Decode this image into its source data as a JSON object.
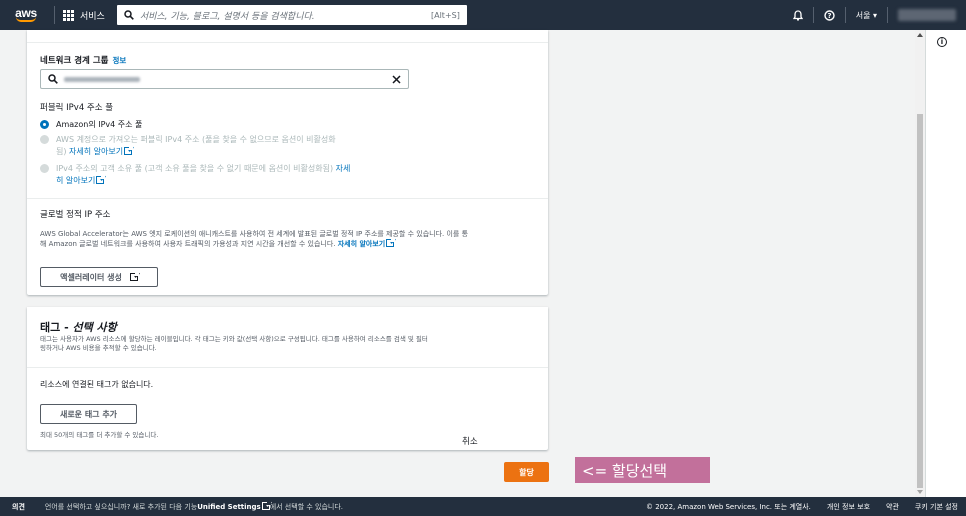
{
  "topnav": {
    "logo": "aws",
    "services_label": "서비스",
    "search_placeholder": "서비스, 기능, 블로그, 설명서 등을 검색합니다.",
    "search_shortcut": "[Alt+S]",
    "region": "서울 ▾",
    "icons": [
      "grid-icon",
      "search-icon",
      "bell-icon",
      "help-icon"
    ]
  },
  "network": {
    "label": "네트워크 경계 그룹",
    "info": "정보",
    "field_value": "ap-northeast-2"
  },
  "pool": {
    "label": "퍼블릭 IPv4 주소 풀",
    "options": [
      {
        "text": "Amazon의 IPv4 주소 풀",
        "selected": true,
        "disabled": false
      },
      {
        "line1": "AWS 계정으로 가져오는 퍼블릭 IPv4 주소 (풀을 찾을 수 없으므로 옵션이 비활성화",
        "line2": "됨)",
        "link": "자세히 알아보기",
        "selected": false,
        "disabled": true
      },
      {
        "line1": "IPv4 주소의 고객 소유 풀 (고객 소유 풀을 찾을 수 없기 때문에 옵션이 비활성화됨)",
        "link_a": "자세",
        "link_b": "히 알아보기",
        "selected": false,
        "disabled": true
      }
    ]
  },
  "global_ip": {
    "label": "글로벌 정적 IP 주소",
    "desc1": "AWS Global Accelerator는 AWS 엣지 로케이션의 애니캐스트를 사용하여 전 세계에 발표된 글로벌 정적 IP 주소를 제공할 수 있습니다. 이를 통",
    "desc2": "해 Amazon 글로벌 네트워크를 사용하여 사용자 트래픽의 가용성과 지연 시간을 개선할 수 있습니다.",
    "link": "자세히 알아보기",
    "button": "액셀러레이터 생성"
  },
  "tags": {
    "title": "태그 -",
    "title_italic": "선택 사항",
    "desc1": "태그는 사용자가 AWS 리소스에 할당하는 레이블입니다. 각 태그는 키와 값(선택 사항)으로 구성됩니다. 태그를 사용하여 리소스를 검색 및 필터",
    "desc2": "링하거나 AWS 비용을 추적할 수 있습니다.",
    "empty": "리소스에 연결된 태그가 없습니다.",
    "add_button": "새로운 태그 추가",
    "limit": "최대 50개의 태그를 더 추가할 수 있습니다."
  },
  "actions": {
    "cancel": "취소",
    "allocate": "할당"
  },
  "annotation": "<= 할당선택",
  "footer": {
    "feedback": "의견",
    "lang_prefix": "언어를 선택하고 싶으십니까? 새로 추가된 다음 기능",
    "lang_bold": "Unified Settings",
    "lang_suffix": "에서 선택할 수 있습니다.",
    "copyright": "© 2022, Amazon Web Services, Inc. 또는 계열사.",
    "privacy": "개인 정보 보호",
    "terms": "약관",
    "cookies": "쿠키 기본 설정"
  },
  "colors": {
    "nav": "#232f3e",
    "primary": "#ec7211",
    "link": "#0073bb",
    "annotation": "#c2709b"
  }
}
